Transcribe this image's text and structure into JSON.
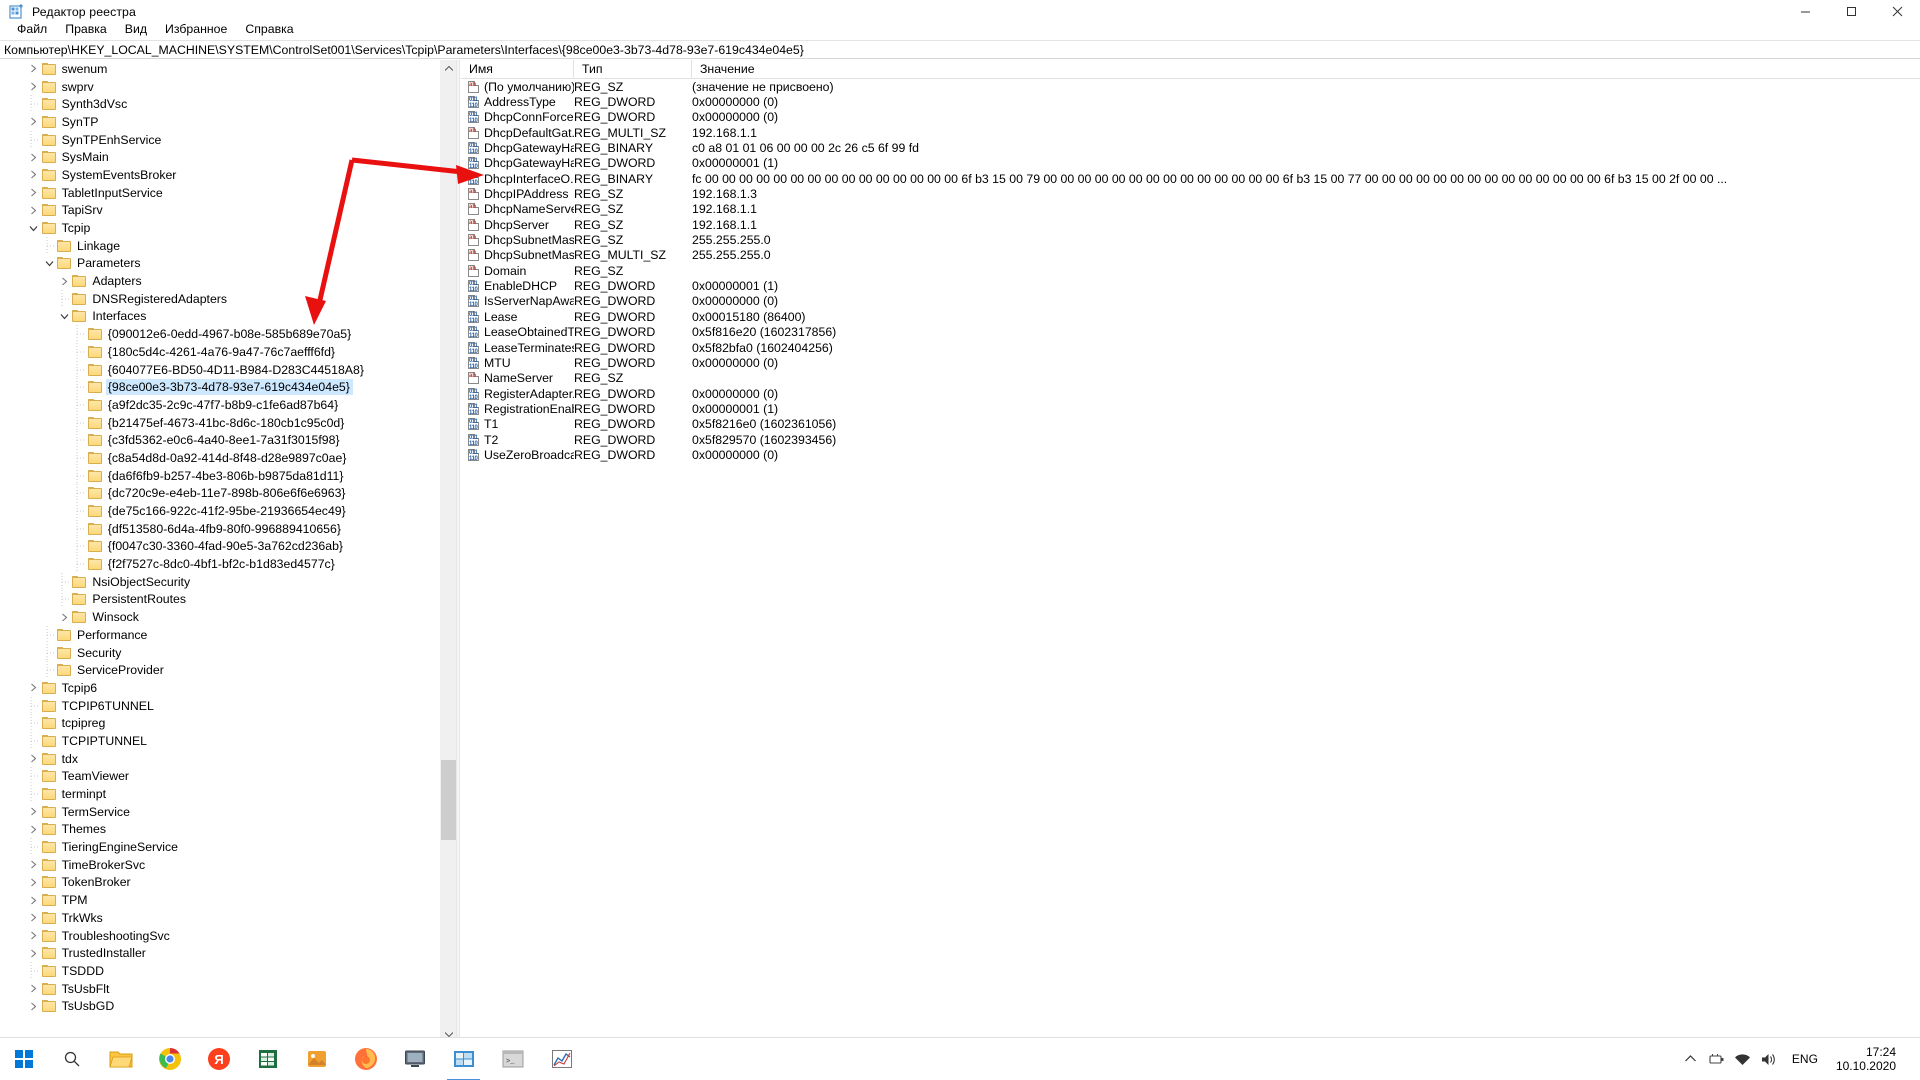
{
  "window": {
    "title": "Редактор реестра",
    "icon": "registry-editor-icon",
    "minimize_label": "Свернуть",
    "maximize_label": "Развернуть",
    "close_label": "Закрыть"
  },
  "menu": {
    "items": [
      {
        "label": "Файл"
      },
      {
        "label": "Правка"
      },
      {
        "label": "Вид"
      },
      {
        "label": "Избранное"
      },
      {
        "label": "Справка"
      }
    ]
  },
  "address": {
    "path": "Компьютер\\HKEY_LOCAL_MACHINE\\SYSTEM\\ControlSet001\\Services\\Tcpip\\Parameters\\Interfaces\\{98ce00e3-3b73-4d78-93e7-619c434e04e5}"
  },
  "tree": {
    "nodes": [
      {
        "label": "swenum",
        "indent": 4,
        "expander": "collapsed",
        "selected": false
      },
      {
        "label": "swprv",
        "indent": 4,
        "expander": "collapsed",
        "selected": false
      },
      {
        "label": "Synth3dVsc",
        "indent": 4,
        "expander": "none",
        "selected": false
      },
      {
        "label": "SynTP",
        "indent": 4,
        "expander": "collapsed",
        "selected": false
      },
      {
        "label": "SynTPEnhService",
        "indent": 4,
        "expander": "none",
        "selected": false
      },
      {
        "label": "SysMain",
        "indent": 4,
        "expander": "collapsed",
        "selected": false
      },
      {
        "label": "SystemEventsBroker",
        "indent": 4,
        "expander": "collapsed",
        "selected": false
      },
      {
        "label": "TabletInputService",
        "indent": 4,
        "expander": "collapsed",
        "selected": false
      },
      {
        "label": "TapiSrv",
        "indent": 4,
        "expander": "collapsed",
        "selected": false
      },
      {
        "label": "Tcpip",
        "indent": 4,
        "expander": "expanded",
        "selected": false
      },
      {
        "label": "Linkage",
        "indent": 5,
        "expander": "none",
        "selected": false
      },
      {
        "label": "Parameters",
        "indent": 5,
        "expander": "expanded",
        "selected": false
      },
      {
        "label": "Adapters",
        "indent": 6,
        "expander": "collapsed",
        "selected": false
      },
      {
        "label": "DNSRegisteredAdapters",
        "indent": 6,
        "expander": "none",
        "selected": false
      },
      {
        "label": "Interfaces",
        "indent": 6,
        "expander": "expanded",
        "selected": false
      },
      {
        "label": "{090012e6-0edd-4967-b08e-585b689e70a5}",
        "indent": 7,
        "expander": "none",
        "selected": false
      },
      {
        "label": "{180c5d4c-4261-4a76-9a47-76c7aefff6fd}",
        "indent": 7,
        "expander": "none",
        "selected": false
      },
      {
        "label": "{604077E6-BD50-4D11-B984-D283C44518A8}",
        "indent": 7,
        "expander": "none",
        "selected": false
      },
      {
        "label": "{98ce00e3-3b73-4d78-93e7-619c434e04e5}",
        "indent": 7,
        "expander": "none",
        "selected": true
      },
      {
        "label": "{a9f2dc35-2c9c-47f7-b8b9-c1fe6ad87b64}",
        "indent": 7,
        "expander": "none",
        "selected": false
      },
      {
        "label": "{b21475ef-4673-41bc-8d6c-180cb1c95c0d}",
        "indent": 7,
        "expander": "none",
        "selected": false
      },
      {
        "label": "{c3fd5362-e0c6-4a40-8ee1-7a31f3015f98}",
        "indent": 7,
        "expander": "none",
        "selected": false
      },
      {
        "label": "{c8a54d8d-0a92-414d-8f48-d28e9897c0ae}",
        "indent": 7,
        "expander": "none",
        "selected": false
      },
      {
        "label": "{da6f6fb9-b257-4be3-806b-b9875da81d11}",
        "indent": 7,
        "expander": "none",
        "selected": false
      },
      {
        "label": "{dc720c9e-e4eb-11e7-898b-806e6f6e6963}",
        "indent": 7,
        "expander": "none",
        "selected": false
      },
      {
        "label": "{de75c166-922c-41f2-95be-21936654ec49}",
        "indent": 7,
        "expander": "none",
        "selected": false
      },
      {
        "label": "{df513580-6d4a-4fb9-80f0-996889410656}",
        "indent": 7,
        "expander": "none",
        "selected": false
      },
      {
        "label": "{f0047c30-3360-4fad-90e5-3a762cd236ab}",
        "indent": 7,
        "expander": "none",
        "selected": false
      },
      {
        "label": "{f2f7527c-8dc0-4bf1-bf2c-b1d83ed4577c}",
        "indent": 7,
        "expander": "none",
        "selected": false
      },
      {
        "label": "NsiObjectSecurity",
        "indent": 6,
        "expander": "none",
        "selected": false
      },
      {
        "label": "PersistentRoutes",
        "indent": 6,
        "expander": "none",
        "selected": false
      },
      {
        "label": "Winsock",
        "indent": 6,
        "expander": "collapsed",
        "selected": false
      },
      {
        "label": "Performance",
        "indent": 5,
        "expander": "none",
        "selected": false
      },
      {
        "label": "Security",
        "indent": 5,
        "expander": "none",
        "selected": false
      },
      {
        "label": "ServiceProvider",
        "indent": 5,
        "expander": "none",
        "selected": false
      },
      {
        "label": "Tcpip6",
        "indent": 4,
        "expander": "collapsed",
        "selected": false
      },
      {
        "label": "TCPIP6TUNNEL",
        "indent": 4,
        "expander": "none",
        "selected": false
      },
      {
        "label": "tcpipreg",
        "indent": 4,
        "expander": "none",
        "selected": false
      },
      {
        "label": "TCPIPTUNNEL",
        "indent": 4,
        "expander": "none",
        "selected": false
      },
      {
        "label": "tdx",
        "indent": 4,
        "expander": "collapsed",
        "selected": false
      },
      {
        "label": "TeamViewer",
        "indent": 4,
        "expander": "none",
        "selected": false
      },
      {
        "label": "terminpt",
        "indent": 4,
        "expander": "none",
        "selected": false
      },
      {
        "label": "TermService",
        "indent": 4,
        "expander": "collapsed",
        "selected": false
      },
      {
        "label": "Themes",
        "indent": 4,
        "expander": "collapsed",
        "selected": false
      },
      {
        "label": "TieringEngineService",
        "indent": 4,
        "expander": "none",
        "selected": false
      },
      {
        "label": "TimeBrokerSvc",
        "indent": 4,
        "expander": "collapsed",
        "selected": false
      },
      {
        "label": "TokenBroker",
        "indent": 4,
        "expander": "collapsed",
        "selected": false
      },
      {
        "label": "TPM",
        "indent": 4,
        "expander": "collapsed",
        "selected": false
      },
      {
        "label": "TrkWks",
        "indent": 4,
        "expander": "collapsed",
        "selected": false
      },
      {
        "label": "TroubleshootingSvc",
        "indent": 4,
        "expander": "collapsed",
        "selected": false
      },
      {
        "label": "TrustedInstaller",
        "indent": 4,
        "expander": "collapsed",
        "selected": false
      },
      {
        "label": "TSDDD",
        "indent": 4,
        "expander": "none",
        "selected": false
      },
      {
        "label": "TsUsbFlt",
        "indent": 4,
        "expander": "collapsed",
        "selected": false
      },
      {
        "label": "TsUsbGD",
        "indent": 4,
        "expander": "collapsed",
        "selected": false
      }
    ]
  },
  "list": {
    "columns": [
      "Имя",
      "Тип",
      "Значение"
    ],
    "rows": [
      {
        "icon": "sz",
        "name": "(По умолчанию)",
        "type": "REG_SZ",
        "value": "(значение не присвоено)"
      },
      {
        "icon": "dword",
        "name": "AddressType",
        "type": "REG_DWORD",
        "value": "0x00000000 (0)"
      },
      {
        "icon": "dword",
        "name": "DhcpConnForce...",
        "type": "REG_DWORD",
        "value": "0x00000000 (0)"
      },
      {
        "icon": "sz",
        "name": "DhcpDefaultGat...",
        "type": "REG_MULTI_SZ",
        "value": "192.168.1.1"
      },
      {
        "icon": "dword",
        "name": "DhcpGatewayHa...",
        "type": "REG_BINARY",
        "value": "c0 a8 01 01 06 00 00 00 2c 26 c5 6f 99 fd"
      },
      {
        "icon": "dword",
        "name": "DhcpGatewayHa...",
        "type": "REG_DWORD",
        "value": "0x00000001 (1)"
      },
      {
        "icon": "dword",
        "name": "DhcpInterfaceO...",
        "type": "REG_BINARY",
        "value": "fc 00 00 00 00 00 00 00 00 00 00 00 00 00 00 00 6f b3 15 00 79 00 00 00 00 00 00 00 00 00 00 00 00 00 00 6f b3 15 00 77 00 00 00 00 00 00 00 00 00 00 00 00 00 00 6f b3 15 00 2f 00 00 ..."
      },
      {
        "icon": "sz",
        "name": "DhcpIPAddress",
        "type": "REG_SZ",
        "value": "192.168.1.3"
      },
      {
        "icon": "sz",
        "name": "DhcpNameServer",
        "type": "REG_SZ",
        "value": "192.168.1.1"
      },
      {
        "icon": "sz",
        "name": "DhcpServer",
        "type": "REG_SZ",
        "value": "192.168.1.1"
      },
      {
        "icon": "sz",
        "name": "DhcpSubnetMask",
        "type": "REG_SZ",
        "value": "255.255.255.0"
      },
      {
        "icon": "sz",
        "name": "DhcpSubnetMas...",
        "type": "REG_MULTI_SZ",
        "value": "255.255.255.0"
      },
      {
        "icon": "sz",
        "name": "Domain",
        "type": "REG_SZ",
        "value": ""
      },
      {
        "icon": "dword",
        "name": "EnableDHCP",
        "type": "REG_DWORD",
        "value": "0x00000001 (1)"
      },
      {
        "icon": "dword",
        "name": "IsServerNapAware",
        "type": "REG_DWORD",
        "value": "0x00000000 (0)"
      },
      {
        "icon": "dword",
        "name": "Lease",
        "type": "REG_DWORD",
        "value": "0x00015180 (86400)"
      },
      {
        "icon": "dword",
        "name": "LeaseObtainedTi...",
        "type": "REG_DWORD",
        "value": "0x5f816e20 (1602317856)"
      },
      {
        "icon": "dword",
        "name": "LeaseTerminates...",
        "type": "REG_DWORD",
        "value": "0x5f82bfa0 (1602404256)"
      },
      {
        "icon": "dword",
        "name": "MTU",
        "type": "REG_DWORD",
        "value": "0x00000000 (0)"
      },
      {
        "icon": "sz",
        "name": "NameServer",
        "type": "REG_SZ",
        "value": ""
      },
      {
        "icon": "dword",
        "name": "RegisterAdapter...",
        "type": "REG_DWORD",
        "value": "0x00000000 (0)"
      },
      {
        "icon": "dword",
        "name": "RegistrationEnab...",
        "type": "REG_DWORD",
        "value": "0x00000001 (1)"
      },
      {
        "icon": "dword",
        "name": "T1",
        "type": "REG_DWORD",
        "value": "0x5f8216e0 (1602361056)"
      },
      {
        "icon": "dword",
        "name": "T2",
        "type": "REG_DWORD",
        "value": "0x5f829570 (1602393456)"
      },
      {
        "icon": "dword",
        "name": "UseZeroBroadcast",
        "type": "REG_DWORD",
        "value": "0x00000000 (0)"
      }
    ]
  },
  "annotation": {
    "type": "red-arrow",
    "color": "#e8110f",
    "points_to_row": "DhcpInterfaceO...",
    "points_to_tree_node": "{98ce00e3-3b73-4d78-93e7-619c434e04e5}"
  },
  "taskbar": {
    "start_label": "Пуск",
    "search_label": "Поиск",
    "apps": [
      {
        "name": "task-view-icon"
      },
      {
        "name": "file-explorer-icon"
      },
      {
        "name": "chrome-icon"
      },
      {
        "name": "yandex-browser-icon"
      },
      {
        "name": "excel-icon"
      },
      {
        "name": "photos-icon"
      },
      {
        "name": "firefox-icon"
      },
      {
        "name": "remote-desktop-icon"
      },
      {
        "name": "registry-editor-icon",
        "active": true
      },
      {
        "name": "terminal-icon"
      },
      {
        "name": "charts-app-icon"
      }
    ],
    "tray": {
      "show_hidden_label": "Отображать скрытые значки",
      "icons": [
        "usb-icon",
        "network-icon",
        "volume-icon"
      ],
      "language": "ENG",
      "time": "17:24",
      "date": "10.10.2020"
    }
  }
}
